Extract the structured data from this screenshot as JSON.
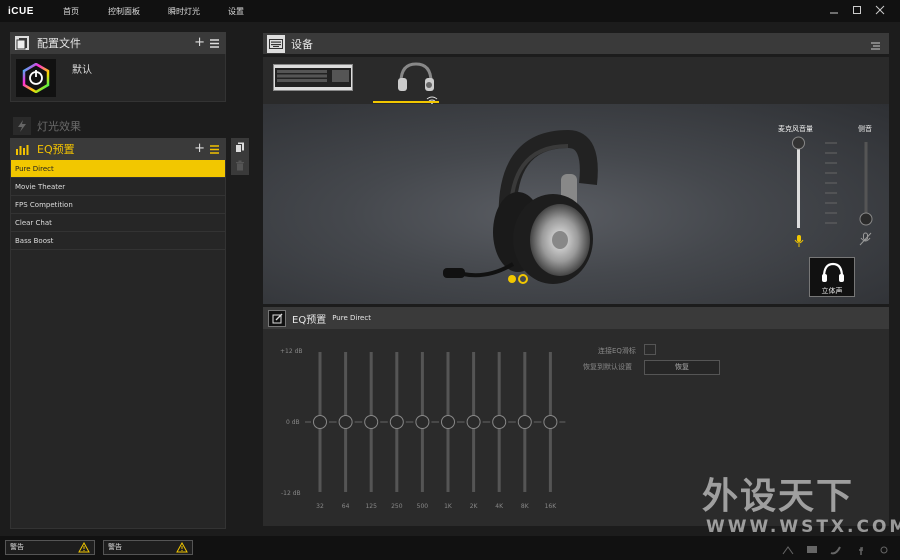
{
  "app": {
    "logo": "iCUE"
  },
  "nav": {
    "items": [
      "首页",
      "控制面板",
      "瞬时灯光",
      "设置"
    ]
  },
  "window_controls": [
    "minimize-icon",
    "maximize-icon",
    "close-icon"
  ],
  "profiles": {
    "title": "配置文件",
    "add_label": "+",
    "current": "默认"
  },
  "lighting": {
    "title": "灯光效果"
  },
  "eq_presets": {
    "title": "EQ预置",
    "add_label": "+",
    "items": [
      "Pure Direct",
      "Movie Theater",
      "FPS Competition",
      "Clear Chat",
      "Bass Boost"
    ],
    "selected_index": 0
  },
  "devices": {
    "title": "设备",
    "selected": "headset"
  },
  "mic": {
    "volume_label": "麦克风音量",
    "volume_fraction": 1.0,
    "sidetone_label": "侧音",
    "sidetone_fraction": 0.0
  },
  "stereo": {
    "label": "立体声"
  },
  "eq_panel": {
    "title": "EQ预置",
    "preset_name": "Pure Direct",
    "db_labels": [
      "+12 dB",
      "0 dB",
      "-12 dB"
    ],
    "bands": [
      "32",
      "64",
      "125",
      "250",
      "500",
      "1K",
      "2K",
      "4K",
      "8K",
      "16K"
    ],
    "band_values_db": [
      0,
      0,
      0,
      0,
      0,
      0,
      0,
      0,
      0,
      0
    ],
    "link_sliders_label": "连接EQ滑标",
    "restore_default_label": "恢复到默认设置",
    "restore_button": "恢复"
  },
  "status": {
    "warnings": [
      "警告",
      "警告"
    ]
  },
  "watermark": {
    "line1": "外设天下",
    "line2": "WWW.WSTX.COM"
  },
  "colors": {
    "accent": "#f2c700",
    "panel_header": "#3a3a3a",
    "background": "#1c1c1c"
  }
}
